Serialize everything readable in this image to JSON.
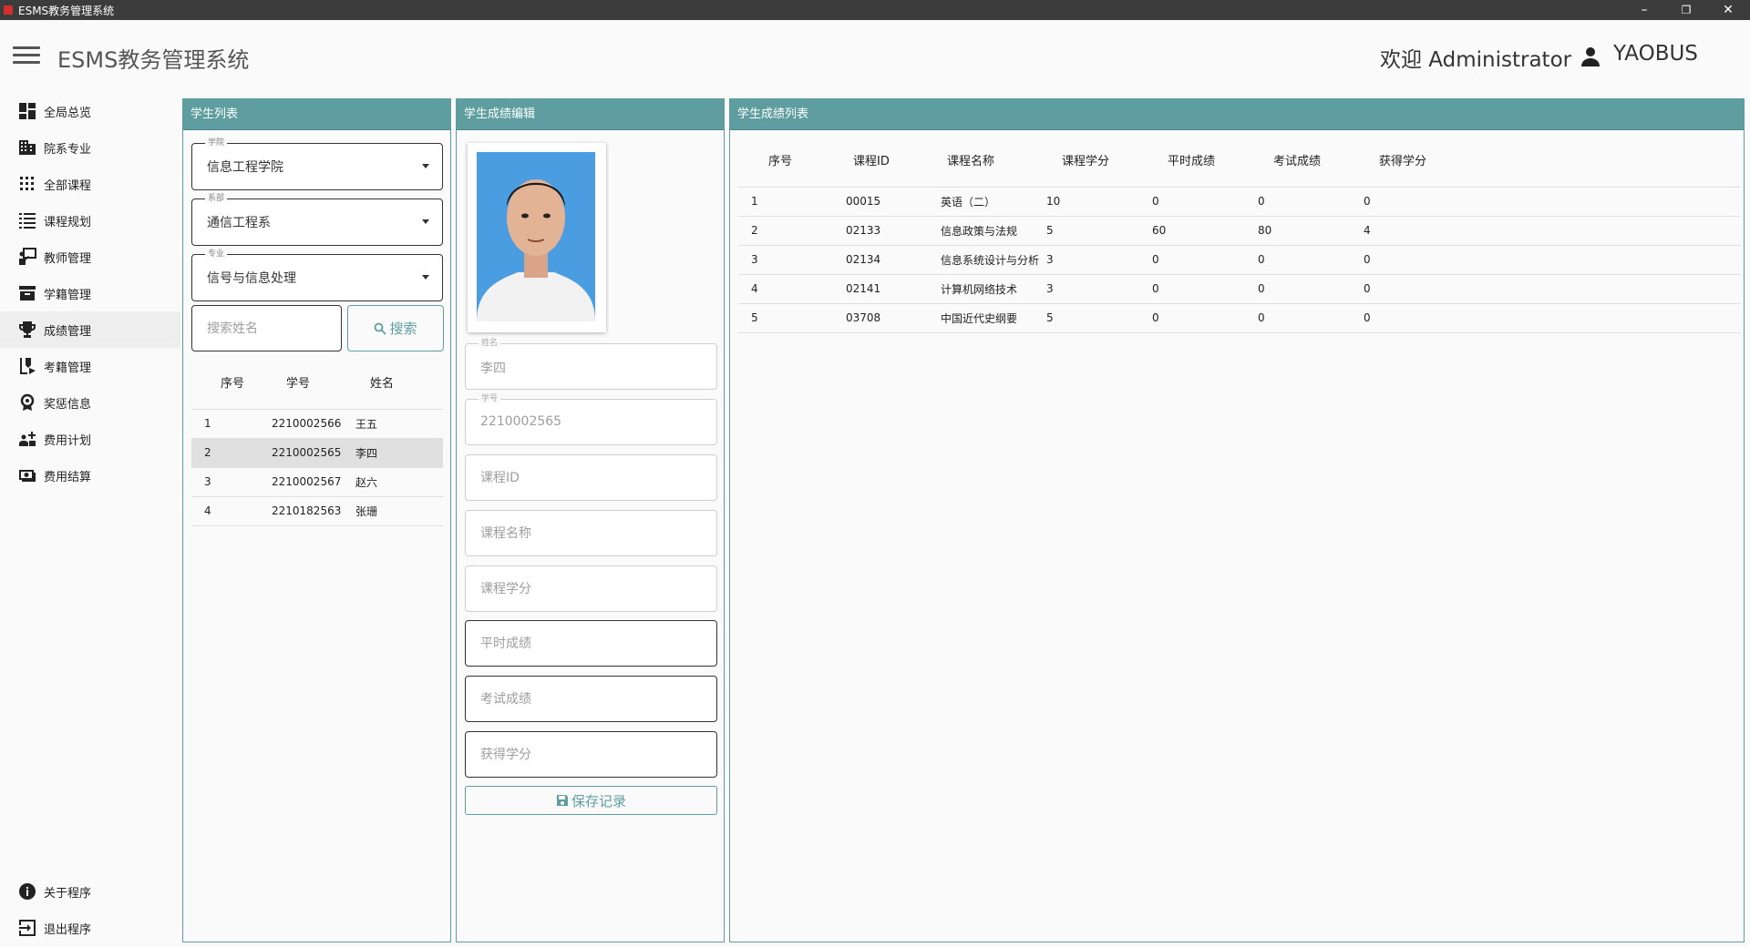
{
  "window": {
    "title": "ESMS教务管理系统",
    "minimize": "–",
    "restore": "❐",
    "close": "✕"
  },
  "header": {
    "app_title": "ESMS教务管理系统",
    "welcome": "欢迎  Administrator",
    "user_icon": "person-icon",
    "user_name": "YAOBUS"
  },
  "sidebar": {
    "items": [
      {
        "label": "全局总览",
        "icon": "dashboard-icon"
      },
      {
        "label": "院系专业",
        "icon": "building-icon"
      },
      {
        "label": "全部课程",
        "icon": "grid-dots-icon"
      },
      {
        "label": "课程规划",
        "icon": "list-icon"
      },
      {
        "label": "教师管理",
        "icon": "teacher-icon"
      },
      {
        "label": "学籍管理",
        "icon": "archive-icon"
      },
      {
        "label": "成绩管理",
        "icon": "trophy-icon"
      },
      {
        "label": "考籍管理",
        "icon": "exam-icon"
      },
      {
        "label": "奖惩信息",
        "icon": "award-icon"
      },
      {
        "label": "费用计划",
        "icon": "plan-icon"
      },
      {
        "label": "费用结算",
        "icon": "cash-icon"
      }
    ],
    "active_index": 6,
    "bottom": [
      {
        "label": "关于程序",
        "icon": "info-icon"
      },
      {
        "label": "退出程序",
        "icon": "exit-icon"
      }
    ]
  },
  "student_panel": {
    "title": "学生列表",
    "college": {
      "legend": "学院",
      "value": "信息工程学院"
    },
    "department": {
      "legend": "系部",
      "value": "通信工程系"
    },
    "major": {
      "legend": "专业",
      "value": "信号与信息处理"
    },
    "search_placeholder": "搜索姓名",
    "search_button": "搜索",
    "columns": [
      "序号",
      "学号",
      "姓名"
    ],
    "rows": [
      [
        "1",
        "2210002566",
        "王五"
      ],
      [
        "2",
        "2210002565",
        "李四"
      ],
      [
        "3",
        "2210002567",
        "赵六"
      ],
      [
        "4",
        "2210182563",
        "张珊"
      ]
    ],
    "selected_row": 1
  },
  "edit_panel": {
    "title": "学生成绩编辑",
    "name_legend": "姓名",
    "name_value": "李四",
    "id_legend": "学号",
    "id_value": "2210002565",
    "course_id_placeholder": "课程ID",
    "course_name_placeholder": "课程名称",
    "course_credit_placeholder": "课程学分",
    "usual_score_placeholder": "平时成绩",
    "exam_score_placeholder": "考试成绩",
    "earned_credit_placeholder": "获得学分",
    "save_button": "保存记录"
  },
  "score_panel": {
    "title": "学生成绩列表",
    "columns": [
      "序号",
      "课程ID",
      "课程名称",
      "课程学分",
      "平时成绩",
      "考试成绩",
      "获得学分"
    ],
    "rows": [
      [
        "1",
        "00015",
        "英语（二）",
        "10",
        "0",
        "0",
        "0"
      ],
      [
        "2",
        "02133",
        "信息政策与法规",
        "5",
        "60",
        "80",
        "4"
      ],
      [
        "3",
        "02134",
        "信息系统设计与分析",
        "3",
        "0",
        "0",
        "0"
      ],
      [
        "4",
        "02141",
        "计算机网络技术",
        "3",
        "0",
        "0",
        "0"
      ],
      [
        "5",
        "03708",
        "中国近代史纲要",
        "5",
        "0",
        "0",
        "0"
      ]
    ]
  },
  "colors": {
    "accent": "#5f9ea0",
    "titlebar": "#3c3c3c",
    "photo_bg": "#4a9de0"
  }
}
